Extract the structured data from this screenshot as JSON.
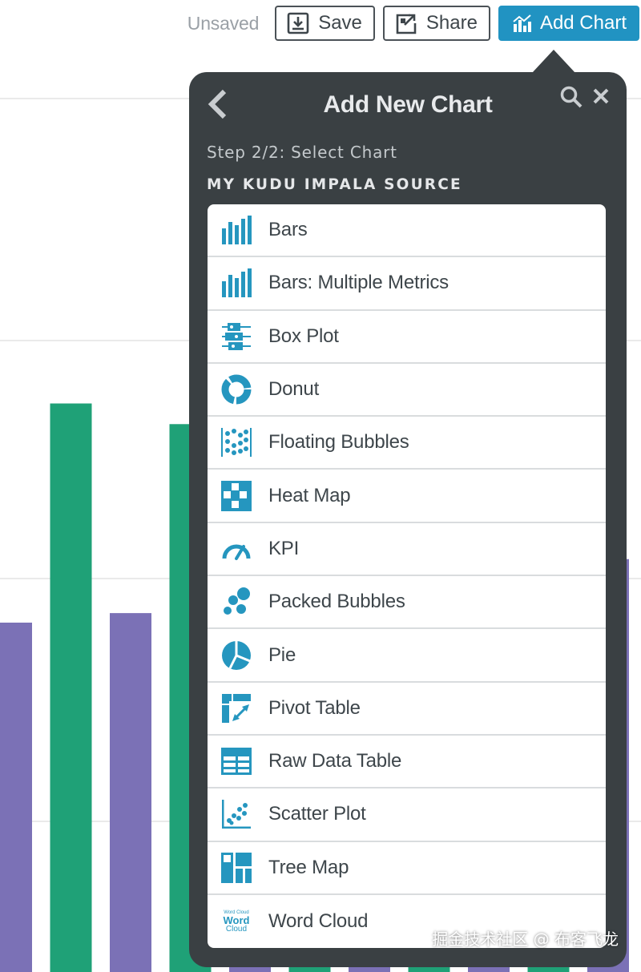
{
  "colors": {
    "accent": "#2193c2",
    "icon": "#2596bf",
    "popover_bg": "#3a4043",
    "bar_green": "#1fa177",
    "bar_purple": "#7b71b6"
  },
  "toolbar": {
    "status_text": "Unsaved",
    "save_label": "Save",
    "share_label": "Share",
    "add_chart_label": "Add Chart"
  },
  "popover": {
    "title": "Add New Chart",
    "step_text": "Step 2/2: Select Chart",
    "source_name": "MY KUDU IMPALA SOURCE",
    "chart_types": [
      {
        "label": "Bars",
        "icon": "bars-icon"
      },
      {
        "label": "Bars: Multiple Metrics",
        "icon": "bars-multiple-metrics-icon"
      },
      {
        "label": "Box Plot",
        "icon": "box-plot-icon"
      },
      {
        "label": "Donut",
        "icon": "donut-icon"
      },
      {
        "label": "Floating Bubbles",
        "icon": "floating-bubbles-icon"
      },
      {
        "label": "Heat Map",
        "icon": "heat-map-icon"
      },
      {
        "label": "KPI",
        "icon": "kpi-gauge-icon"
      },
      {
        "label": "Packed Bubbles",
        "icon": "packed-bubbles-icon"
      },
      {
        "label": "Pie",
        "icon": "pie-icon"
      },
      {
        "label": "Pivot Table",
        "icon": "pivot-table-icon"
      },
      {
        "label": "Raw Data Table",
        "icon": "raw-data-table-icon"
      },
      {
        "label": "Scatter Plot",
        "icon": "scatter-plot-icon"
      },
      {
        "label": "Tree Map",
        "icon": "tree-map-icon"
      },
      {
        "label": "Word Cloud",
        "icon": "word-cloud-icon"
      }
    ],
    "word_cloud_icon_text": {
      "small": "Word Cloud",
      "big": "Word",
      "mid": "Cloud"
    }
  },
  "watermark": "掘金技术社区 @ 布客飞龙",
  "chart_data": {
    "type": "bar",
    "categories": [
      "",
      "",
      "",
      "",
      "",
      "",
      "",
      "",
      "",
      "",
      ""
    ],
    "values": [
      440,
      716,
      452,
      690,
      480,
      560,
      500,
      600,
      460,
      520,
      520
    ],
    "series_colors": [
      "#7b71b6",
      "#1fa177",
      "#7b71b6",
      "#1fa177",
      "#7b71b6",
      "#1fa177",
      "#7b71b6",
      "#1fa177",
      "#7b71b6",
      "#1fa177",
      "#7b71b6"
    ],
    "ylim": [
      0,
      1100
    ],
    "grid": true,
    "title": "",
    "xlabel": "",
    "ylabel": ""
  }
}
